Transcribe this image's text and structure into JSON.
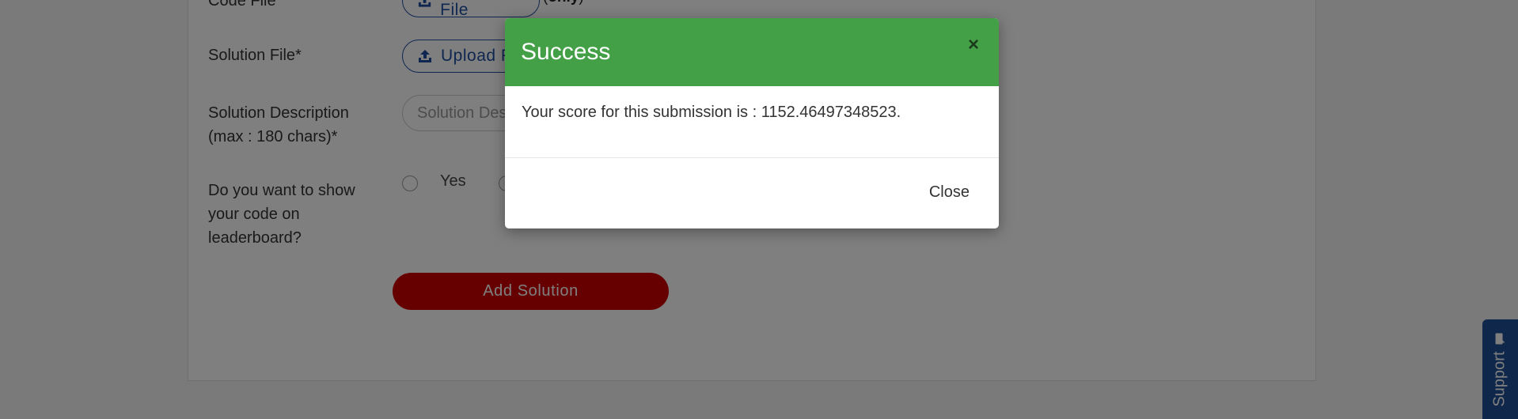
{
  "form": {
    "code_file_label": "Code File",
    "code_upload_label": "Upload File",
    "only_note_open": "(",
    "only_note_bold": "only",
    "only_note_close": ")",
    "solution_file_label": "Solution File*",
    "solution_upload_label": "Upload File",
    "solution_description_label": "Solution Description (max : 180 chars)*",
    "solution_description_placeholder": "Solution Description",
    "show_code_label": "Do you want to show your code on leaderboard?",
    "radio_yes_label": "Yes",
    "add_solution_label": "Add Solution"
  },
  "support": {
    "label": "Support",
    "icon": "chat-icon"
  },
  "modal": {
    "title": "Success",
    "close_x": "×",
    "message": "Your score for this submission is : 1152.46497348523.",
    "close_button": "Close"
  },
  "colors": {
    "modal_header": "#43a047",
    "primary_blue": "#1f4fa0",
    "add_button": "#cc0000",
    "support_tab": "#1f4f97"
  }
}
